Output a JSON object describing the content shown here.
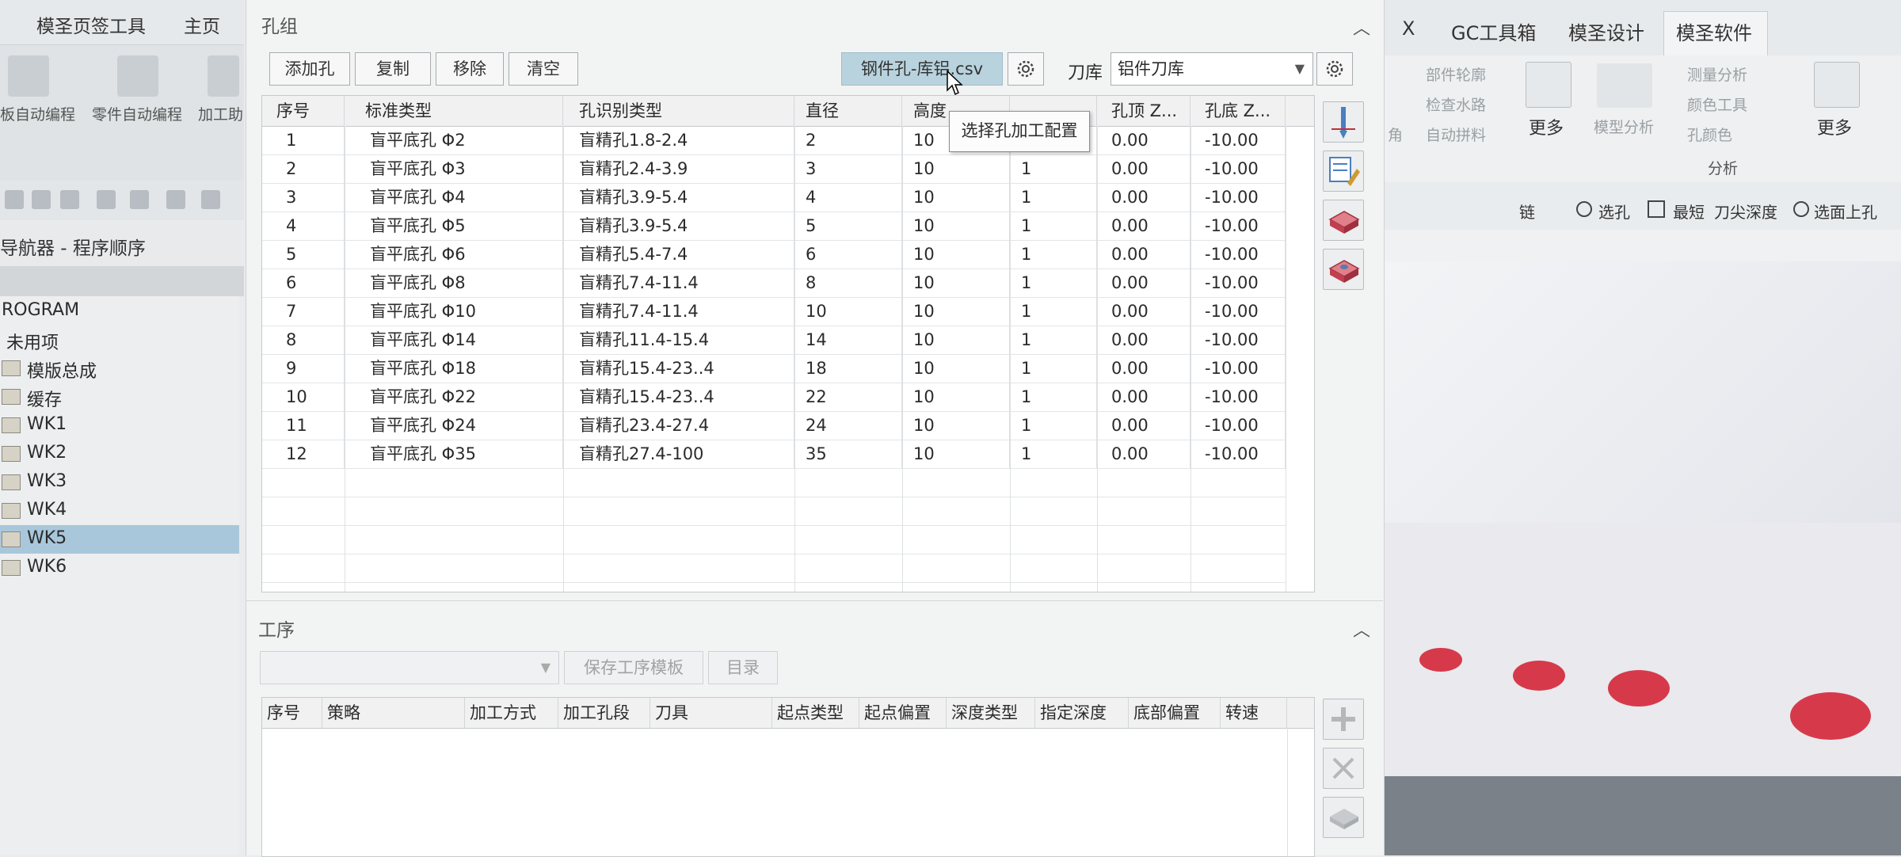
{
  "left_window": {
    "tabs": [
      "模圣页签工具",
      "主页"
    ],
    "ribbon_labels": [
      "板自动编程",
      "零件自动编程",
      "加工助"
    ],
    "navigator_title": "导航器 - 程序顺序",
    "tree": [
      {
        "label": "ROGRAM"
      },
      {
        "label": "未用项"
      },
      {
        "label": "模版总成"
      },
      {
        "label": "缓存"
      },
      {
        "label": "WK1"
      },
      {
        "label": "WK2"
      },
      {
        "label": "WK3"
      },
      {
        "label": "WK4"
      },
      {
        "label": "WK5",
        "selected": true
      },
      {
        "label": "WK6"
      }
    ]
  },
  "right_window": {
    "tabs": [
      "X",
      "GC工具箱",
      "模圣设计",
      "模圣软件"
    ],
    "active_tab": "模圣软件",
    "ribbon_faded": [
      "部件轮廓",
      "检查水路",
      "自动拼料",
      "角",
      "测量分析",
      "颜色工具",
      "孔颜色",
      "模型分析"
    ],
    "more_label": "更多",
    "analysis_label": "分析",
    "toolbar2": {
      "chain_label": "链",
      "select_hole_label": "选孔",
      "shortest_label": "最短",
      "tip_depth_label": "刀尖深度",
      "select_face_hole_label": "选面上孔"
    }
  },
  "hole_group": {
    "title": "孔组",
    "buttons": {
      "add": "添加孔",
      "copy": "复制",
      "remove": "移除",
      "clear": "清空"
    },
    "csv_button": "钢件孔-库铝.csv",
    "tool_lib_label": "刀库",
    "tool_lib_value": "铝件刀库",
    "tooltip": "选择孔加工配置",
    "columns": [
      "序号",
      "标准类型",
      "孔识别类型",
      "直径",
      "高度",
      "",
      "孔顶 Z...",
      "孔底 Z..."
    ],
    "rows": [
      {
        "no": "1",
        "std": "盲平底孔 Φ2",
        "recog": "盲精孔1.8-2.4",
        "dia": "2",
        "h": "10",
        "n": "",
        "top": "0.00",
        "bot": "-10.00"
      },
      {
        "no": "2",
        "std": "盲平底孔 Φ3",
        "recog": "盲精孔2.4-3.9",
        "dia": "3",
        "h": "10",
        "n": "1",
        "top": "0.00",
        "bot": "-10.00"
      },
      {
        "no": "3",
        "std": "盲平底孔 Φ4",
        "recog": "盲精孔3.9-5.4",
        "dia": "4",
        "h": "10",
        "n": "1",
        "top": "0.00",
        "bot": "-10.00"
      },
      {
        "no": "4",
        "std": "盲平底孔 Φ5",
        "recog": "盲精孔3.9-5.4",
        "dia": "5",
        "h": "10",
        "n": "1",
        "top": "0.00",
        "bot": "-10.00"
      },
      {
        "no": "5",
        "std": "盲平底孔 Φ6",
        "recog": "盲精孔5.4-7.4",
        "dia": "6",
        "h": "10",
        "n": "1",
        "top": "0.00",
        "bot": "-10.00"
      },
      {
        "no": "6",
        "std": "盲平底孔 Φ8",
        "recog": "盲精孔7.4-11.4",
        "dia": "8",
        "h": "10",
        "n": "1",
        "top": "0.00",
        "bot": "-10.00"
      },
      {
        "no": "7",
        "std": "盲平底孔 Φ10",
        "recog": "盲精孔7.4-11.4",
        "dia": "10",
        "h": "10",
        "n": "1",
        "top": "0.00",
        "bot": "-10.00"
      },
      {
        "no": "8",
        "std": "盲平底孔 Φ14",
        "recog": "盲精孔11.4-15.4",
        "dia": "14",
        "h": "10",
        "n": "1",
        "top": "0.00",
        "bot": "-10.00"
      },
      {
        "no": "9",
        "std": "盲平底孔 Φ18",
        "recog": "盲精孔15.4-23..4",
        "dia": "18",
        "h": "10",
        "n": "1",
        "top": "0.00",
        "bot": "-10.00"
      },
      {
        "no": "10",
        "std": "盲平底孔 Φ22",
        "recog": "盲精孔15.4-23..4",
        "dia": "22",
        "h": "10",
        "n": "1",
        "top": "0.00",
        "bot": "-10.00"
      },
      {
        "no": "11",
        "std": "盲平底孔 Φ24",
        "recog": "盲精孔23.4-27.4",
        "dia": "24",
        "h": "10",
        "n": "1",
        "top": "0.00",
        "bot": "-10.00"
      },
      {
        "no": "12",
        "std": "盲平底孔 Φ35",
        "recog": "盲精孔27.4-100",
        "dia": "35",
        "h": "10",
        "n": "1",
        "top": "0.00",
        "bot": "-10.00"
      }
    ]
  },
  "process": {
    "title": "工序",
    "save_template": "保存工序模板",
    "directory": "目录",
    "columns": [
      "序号",
      "策略",
      "加工方式",
      "加工孔段",
      "刀具",
      "起点类型",
      "起点偏置",
      "深度类型",
      "指定深度",
      "底部偏置",
      "转速"
    ]
  },
  "colors": {
    "accent_tab": "#b9d3de",
    "selection": "#a9c7db",
    "hole_red": "#d63a4a"
  }
}
